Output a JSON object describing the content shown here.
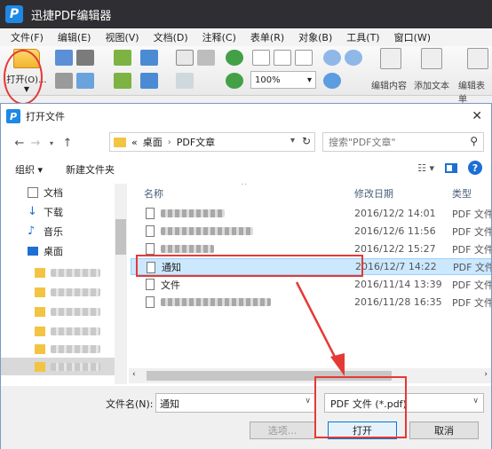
{
  "app": {
    "title": "迅捷PDF编辑器",
    "logo": "P"
  },
  "menu": [
    "文件(F)",
    "编辑(E)",
    "视图(V)",
    "文档(D)",
    "注释(C)",
    "表单(R)",
    "对象(B)",
    "工具(T)",
    "窗口(W)"
  ],
  "toolbar": {
    "open_label": "打开(O)...",
    "zoom_value": "100%",
    "edit_content_label": "编辑内容",
    "add_text_label": "添加文本",
    "edit_form_label": "编辑表单"
  },
  "dialog": {
    "title": "打开文件",
    "logo": "P",
    "breadcrumb": [
      "«",
      "桌面",
      "›",
      "PDF文章"
    ],
    "search_placeholder": "搜索\"PDF文章\"",
    "organize_label": "组织 ▾",
    "new_folder_label": "新建文件夹",
    "nav_items": [
      "文档",
      "下载",
      "音乐",
      "桌面"
    ],
    "columns": {
      "name": "名称",
      "date": "修改日期",
      "type": "类型"
    },
    "files": [
      {
        "date": "2016/12/2 14:01",
        "type": "PDF 文件"
      },
      {
        "date": "2016/12/6 11:56",
        "type": "PDF 文件"
      },
      {
        "date": "2016/12/2 15:27",
        "type": "PDF 文件"
      },
      {
        "name": "通知",
        "date": "2016/12/7 14:22",
        "type": "PDF 文件"
      },
      {
        "name": "文件",
        "date": "2016/11/14 13:39",
        "type": "PDF 文件"
      },
      {
        "date": "2016/11/28 16:35",
        "type": "PDF 文件"
      }
    ],
    "filename_label": "文件名(N):",
    "filename_value": "通知",
    "filetype_value": "PDF 文件 (*.pdf)",
    "options_label": "选项...",
    "open_label": "打开",
    "cancel_label": "取消"
  },
  "colors": {
    "accent": "#1e88e5",
    "highlight": "#e53935",
    "selection": "#cce8ff"
  }
}
